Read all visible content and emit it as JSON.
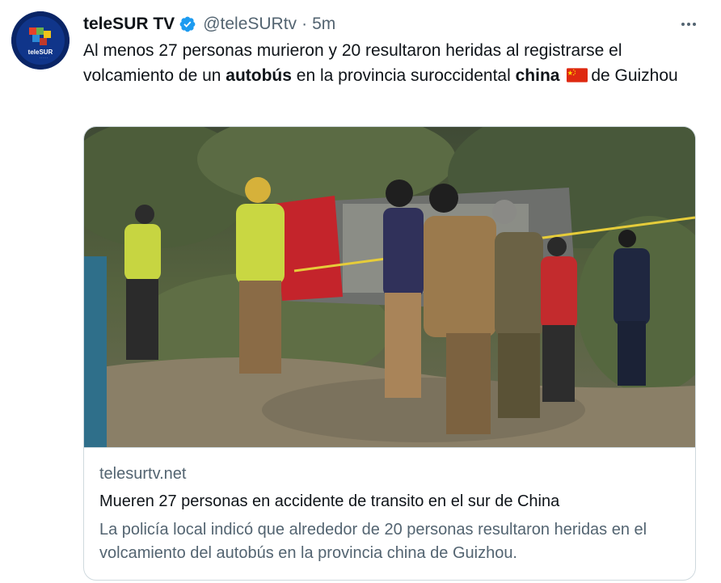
{
  "account": {
    "name": "teleSUR TV",
    "handle": "@teleSURtv",
    "separator": "·",
    "time": "5m",
    "avatar_text": "teleSUR"
  },
  "tweet": {
    "part1": "Al menos 27 personas murieron y 20 resultaron heridas  al registrarse el volcamiento de un ",
    "bold1": "autobús",
    "part2": " en la provincia suroccidental ",
    "bold2": "china",
    "part3": "de Guizhou"
  },
  "card": {
    "domain": "telesurtv.net",
    "title": "Mueren 27 personas en accidente de transito en el sur de China",
    "description": "La policía local indicó que alrededor de 20 personas resultaron heridas en el volcamiento del autobús en la provincia china de Guizhou."
  },
  "icons": {
    "verified": "verified-badge-icon",
    "more": "more-options-icon",
    "flag": "china-flag-emoji"
  },
  "colors": {
    "verified_blue": "#1d9bf0",
    "secondary_text": "#536471",
    "primary_text": "#0f1419",
    "border": "#cfd9de"
  }
}
